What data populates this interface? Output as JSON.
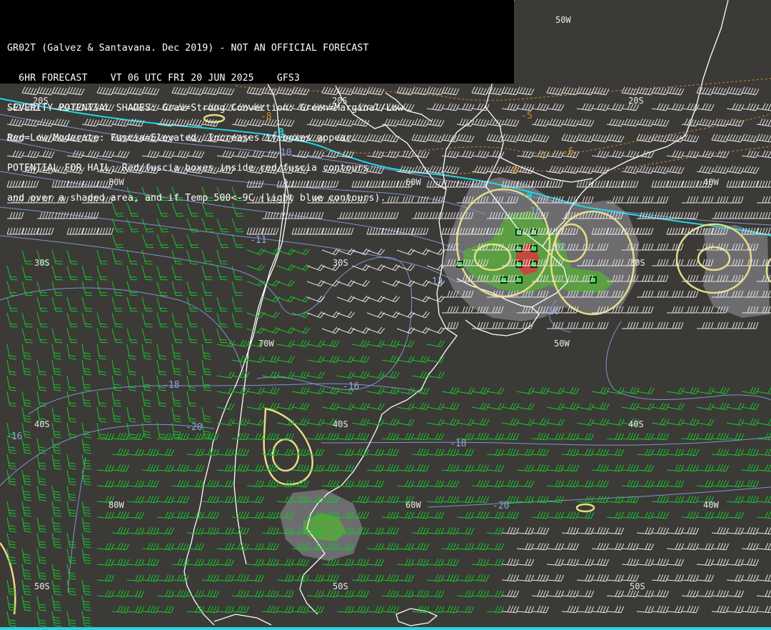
{
  "header": {
    "line1": "GR02T (Galvez & Santavana. Dec 2019) - NOT AN OFFICIAL FORECAST",
    "line2": "  6HR FORECAST    VT 06 UTC FRI 20 JUN 2025    GFS3",
    "line3": "SEVERITY POTENTIAL SHADES: Grav=Strong Convection: Green=Marginal/Low",
    "line4": "Red=Low/Moderate: Fuscia=Elevated. Increases if boxes appear.",
    "line5": "POTENTIAL FOR HAIL: Red/fuscia boxes inside red/fuscia contours",
    "line6": "and over a shaded area, and if Temp 500<-9C (light blue contours)."
  },
  "grid_labels": {
    "lon_50w_top": "50W",
    "lat_20s_left": "20S",
    "lat_20s_mid": "20S",
    "lat_20s_right": "20S",
    "lon_80w_upper": "80W",
    "lon_60w_upper": "60W",
    "lon_40w_upper": "40W",
    "lat_30s_left": "30S",
    "lat_30s_mid": "30S",
    "lat_30s_right": "30S",
    "lon_70w_mid": "70W",
    "lon_50w_mid": "50W",
    "lat_40s_left": "40S",
    "lat_40s_mid": "40S",
    "lat_40s_right": "40S",
    "lon_80w_lower": "80W",
    "lon_60w_lower": "60W",
    "lon_40w_lower": "40W",
    "lat_50s_left": "50S",
    "lat_50s_mid": "50S",
    "lat_50s_right": "50S"
  },
  "temp_labels": {
    "t_m9_a": "-9",
    "t_m9_b": "-9",
    "t_m10_a": "-10",
    "t_m10_b": "-10",
    "t_m11": "-11",
    "t_m12": "-12",
    "t_m13": "-13",
    "t_m16_a": "-16",
    "t_m16_b": "-16",
    "t_m16_c": "-16",
    "t_m18_a": "-18",
    "t_m18_b": "-18",
    "t_m20_a": "-20",
    "t_m20_b": "-20",
    "t_m8_a": "-8",
    "t_m8_b": "-8",
    "t_m7": "-7",
    "t_m6": "-6",
    "t_m5": "-5"
  },
  "colors": {
    "background": "#3b3a37",
    "header_bg": "#000000",
    "coast": "#ffffff",
    "temp_contour": "#7f95d0",
    "temp_m9_contour": "#22d8e8",
    "warm_contour": "#d08a2a",
    "severity_gray": "#6d6d70",
    "severity_green": "#5b9e44",
    "severity_red": "#c24a3c",
    "potential_contour": "#e6dc82",
    "wind_green": "#18c82a",
    "wind_white": "#e8e8e8"
  }
}
